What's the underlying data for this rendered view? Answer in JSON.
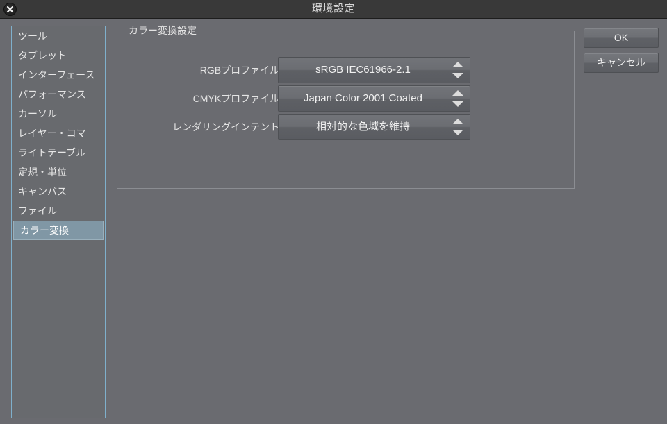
{
  "window": {
    "title": "環境設定",
    "close_icon": "close-x-icon"
  },
  "sidebar": {
    "items": [
      {
        "label": "ツール",
        "selected": false
      },
      {
        "label": "タブレット",
        "selected": false
      },
      {
        "label": "インターフェース",
        "selected": false
      },
      {
        "label": "パフォーマンス",
        "selected": false
      },
      {
        "label": "カーソル",
        "selected": false
      },
      {
        "label": "レイヤー・コマ",
        "selected": false
      },
      {
        "label": "ライトテーブル",
        "selected": false
      },
      {
        "label": "定規・単位",
        "selected": false
      },
      {
        "label": "キャンバス",
        "selected": false
      },
      {
        "label": "ファイル",
        "selected": false
      },
      {
        "label": "カラー変換",
        "selected": true
      }
    ]
  },
  "main": {
    "group_legend": "カラー変換設定",
    "rows": [
      {
        "label": "RGBプロファイル:",
        "value": "sRGB IEC61966-2.1",
        "spinner_icon": "spinner-up-down-icon"
      },
      {
        "label": "CMYKプロファイル:",
        "value": "Japan Color 2001 Coated",
        "spinner_icon": "spinner-up-down-icon"
      },
      {
        "label": "レンダリングインテント:",
        "value": "相対的な色域を維持",
        "spinner_icon": "spinner-up-down-icon"
      }
    ]
  },
  "buttons": {
    "ok": "OK",
    "cancel": "キャンセル"
  },
  "colors": {
    "window_background": "#6a6b70",
    "titlebar": "#393939",
    "selection": "#8097a5",
    "focus_border": "#7fb0cc"
  }
}
